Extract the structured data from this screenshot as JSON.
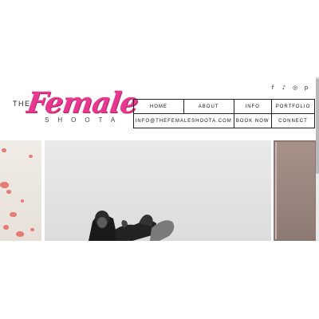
{
  "brand": {
    "prefix": "THE",
    "script": "Female",
    "sub": "SHOOTA",
    "colors": {
      "accent": "#e8378f",
      "text": "#222222"
    }
  },
  "social": [
    {
      "icon": "facebook-icon",
      "glyph": "f"
    },
    {
      "icon": "tiktok-icon",
      "glyph": "♪"
    },
    {
      "icon": "instagram-icon",
      "glyph": "◎"
    },
    {
      "icon": "pinterest-icon",
      "glyph": "p"
    }
  ],
  "nav": {
    "row1": [
      "HOME",
      "ABOUT",
      "INFO",
      "PORTFOLIO"
    ],
    "email": "INFO@THEFEMALESHOOTA.COM",
    "book_now": "BOOK NOW",
    "connect": "CONNECT"
  }
}
